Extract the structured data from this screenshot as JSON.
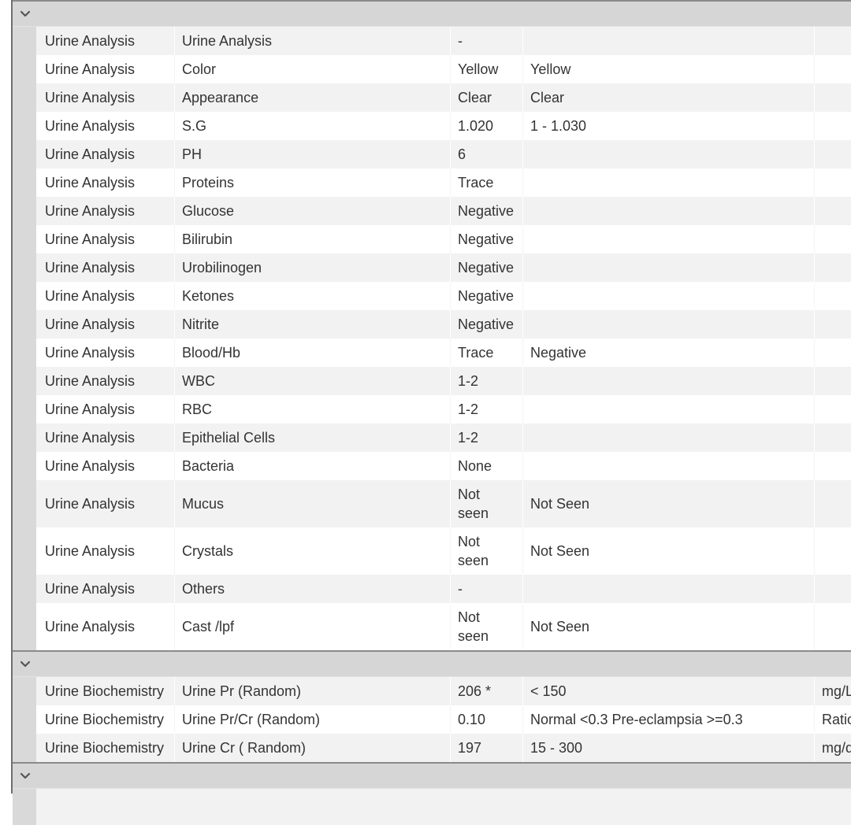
{
  "groups": [
    {
      "toggle_icon": "chevron-down-icon",
      "rows": [
        {
          "section": "Urine Analysis",
          "test": "Urine Analysis",
          "result": "-",
          "reference": "",
          "unit": ""
        },
        {
          "section": "Urine Analysis",
          "test": "Color",
          "result": "Yellow",
          "reference": "Yellow",
          "unit": ""
        },
        {
          "section": "Urine Analysis",
          "test": "Appearance",
          "result": "Clear",
          "reference": "Clear",
          "unit": ""
        },
        {
          "section": "Urine Analysis",
          "test": "S.G",
          "result": "1.020",
          "reference": "1 - 1.030",
          "unit": ""
        },
        {
          "section": "Urine Analysis",
          "test": "PH",
          "result": "6",
          "reference": "",
          "unit": ""
        },
        {
          "section": "Urine Analysis",
          "test": "Proteins",
          "result": "Trace",
          "reference": "",
          "unit": ""
        },
        {
          "section": "Urine Analysis",
          "test": "Glucose",
          "result": "Negative",
          "reference": "",
          "unit": ""
        },
        {
          "section": "Urine Analysis",
          "test": "Bilirubin",
          "result": "Negative",
          "reference": "",
          "unit": ""
        },
        {
          "section": "Urine Analysis",
          "test": "Urobilinogen",
          "result": "Negative",
          "reference": "",
          "unit": ""
        },
        {
          "section": "Urine Analysis",
          "test": "Ketones",
          "result": "Negative",
          "reference": "",
          "unit": ""
        },
        {
          "section": "Urine Analysis",
          "test": "Nitrite",
          "result": "Negative",
          "reference": "",
          "unit": ""
        },
        {
          "section": "Urine Analysis",
          "test": "Blood/Hb",
          "result": "Trace",
          "reference": "Negative",
          "unit": ""
        },
        {
          "section": "Urine Analysis",
          "test": "WBC",
          "result": "1-2",
          "reference": "",
          "unit": ""
        },
        {
          "section": "Urine Analysis",
          "test": "RBC",
          "result": "1-2",
          "reference": "",
          "unit": ""
        },
        {
          "section": "Urine Analysis",
          "test": "Epithelial Cells",
          "result": "1-2",
          "reference": "",
          "unit": ""
        },
        {
          "section": "Urine Analysis",
          "test": "Bacteria",
          "result": "None",
          "reference": "",
          "unit": ""
        },
        {
          "section": "Urine Analysis",
          "test": "Mucus",
          "result": "Not seen",
          "reference": "Not Seen",
          "unit": ""
        },
        {
          "section": "Urine Analysis",
          "test": "Crystals",
          "result": "Not seen",
          "reference": "Not Seen",
          "unit": ""
        },
        {
          "section": "Urine Analysis",
          "test": "Others",
          "result": "-",
          "reference": "",
          "unit": ""
        },
        {
          "section": "Urine Analysis",
          "test": "Cast /lpf",
          "result": "Not seen",
          "reference": "Not Seen",
          "unit": ""
        }
      ]
    },
    {
      "toggle_icon": "chevron-down-icon",
      "rows": [
        {
          "section": "Urine Biochemistry",
          "test": "Urine Pr (Random)",
          "result": "206 *",
          "reference": "< 150",
          "unit": "mg/L"
        },
        {
          "section": "Urine Biochemistry",
          "test": "Urine Pr/Cr (Random)",
          "result": "0.10",
          "reference": "Normal <0.3 Pre-eclampsia >=0.3",
          "unit": "Ratio"
        },
        {
          "section": "Urine Biochemistry",
          "test": "Urine Cr ( Random)",
          "result": "197",
          "reference": "15 - 300",
          "unit": "mg/dL"
        }
      ]
    },
    {
      "toggle_icon": "chevron-down-icon",
      "rows": []
    }
  ],
  "colors": {
    "group_header_bg": "#d6d6d6",
    "row_alt_bg": "#f2f2f2",
    "gutter_bg": "#d9d9d9",
    "text": "#333333"
  }
}
